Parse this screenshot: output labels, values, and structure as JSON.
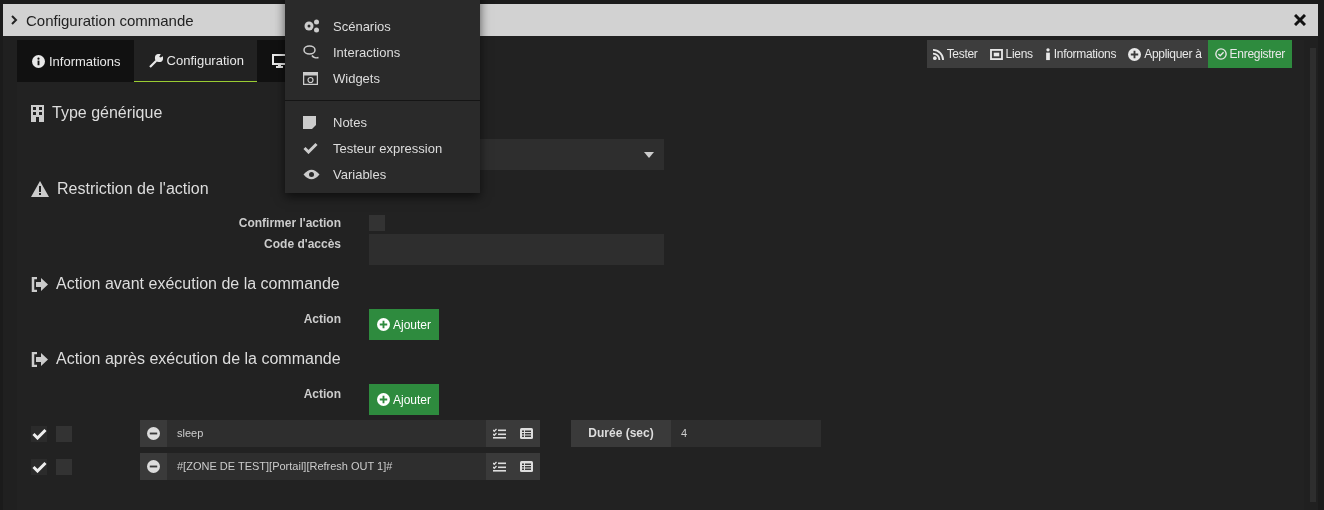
{
  "dialog": {
    "title": "Configuration commande"
  },
  "tabs": [
    {
      "label": "Informations",
      "selected": false
    },
    {
      "label": "Configuration",
      "selected": true
    },
    {
      "selected": false
    }
  ],
  "toolbar": [
    {
      "label": "Tester",
      "kind": "plain"
    },
    {
      "label": "Liens",
      "kind": "plain"
    },
    {
      "label": "Informations",
      "kind": "plain"
    },
    {
      "label": "Appliquer à",
      "kind": "plain"
    },
    {
      "label": "Enregistrer",
      "kind": "primary"
    }
  ],
  "menu": {
    "groups": [
      [
        "Scénarios",
        "Interactions",
        "Widgets"
      ],
      [
        "Notes",
        "Testeur expression",
        "Variables"
      ]
    ]
  },
  "sections": [
    {
      "title": "Type générique",
      "fields": [
        {
          "kind": "select"
        }
      ]
    },
    {
      "title": "Restriction de l'action",
      "fields": [
        {
          "kind": "checkbox",
          "label": "Confirmer l'action",
          "checked": false
        },
        {
          "kind": "input",
          "label": "Code d'accès"
        }
      ]
    },
    {
      "title": "Action avant exécution de la commande",
      "fields": [
        {
          "kind": "button",
          "label": "Action",
          "button": "Ajouter"
        }
      ]
    },
    {
      "title": "Action après exécution de la commande",
      "fields": [
        {
          "kind": "button",
          "label": "Action",
          "button": "Ajouter"
        }
      ],
      "actions": [
        {
          "enabled": true,
          "background": false,
          "command": "sleep",
          "option_label": "Durée (sec)",
          "option_value": "4"
        },
        {
          "enabled": true,
          "background": false,
          "command": "#[ZONE DE TEST][Portail][Refresh OUT 1]#"
        }
      ]
    }
  ]
}
